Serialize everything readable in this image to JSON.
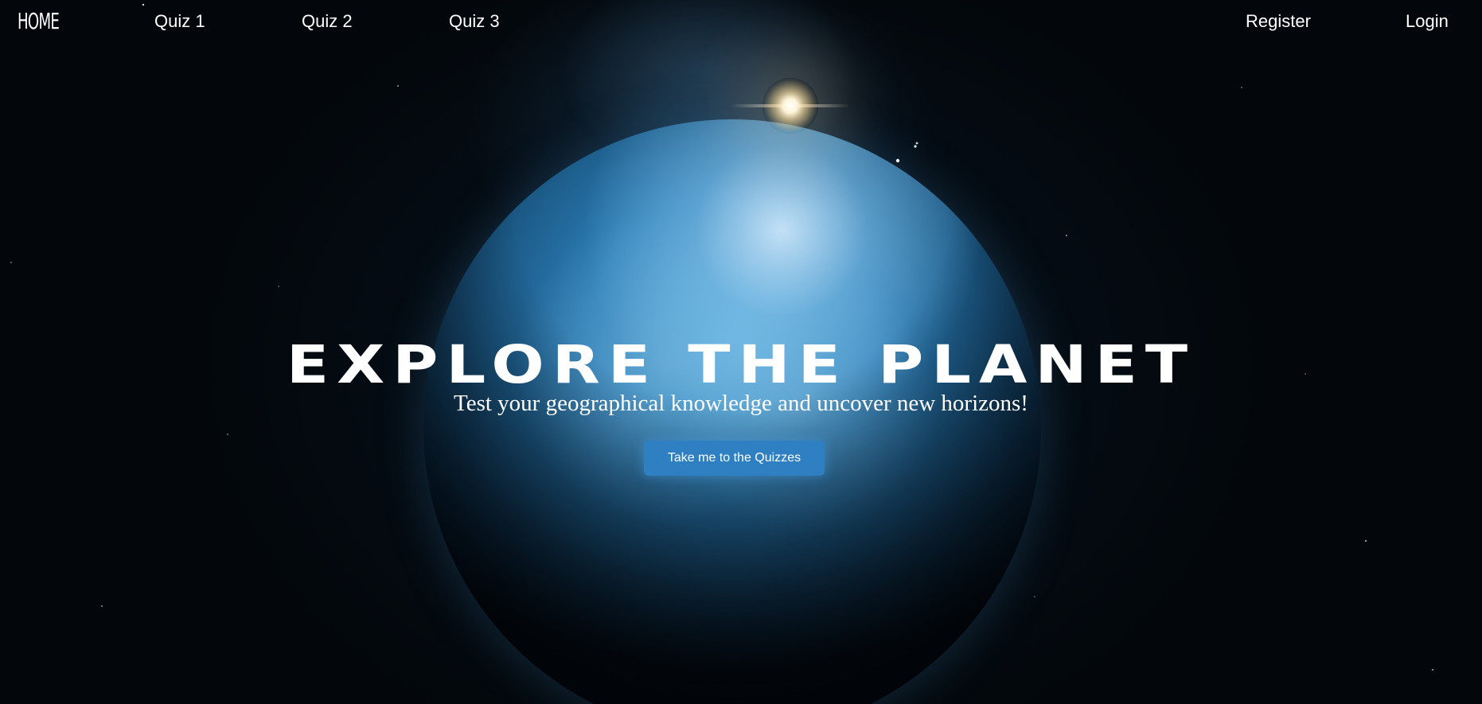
{
  "nav": {
    "brand": "HOME",
    "links": [
      "Quiz 1",
      "Quiz 2",
      "Quiz 3"
    ],
    "register": "Register",
    "login": "Login"
  },
  "hero": {
    "title": "EXPLORE THE PLANET",
    "subtitle": "Test your geographical knowledge and uncover new horizons!",
    "cta": "Take me to the Quizzes"
  },
  "colors": {
    "background": "#03070b",
    "planet": "#2c7fb8",
    "button": "#2f80c2",
    "text": "#ffffff"
  }
}
